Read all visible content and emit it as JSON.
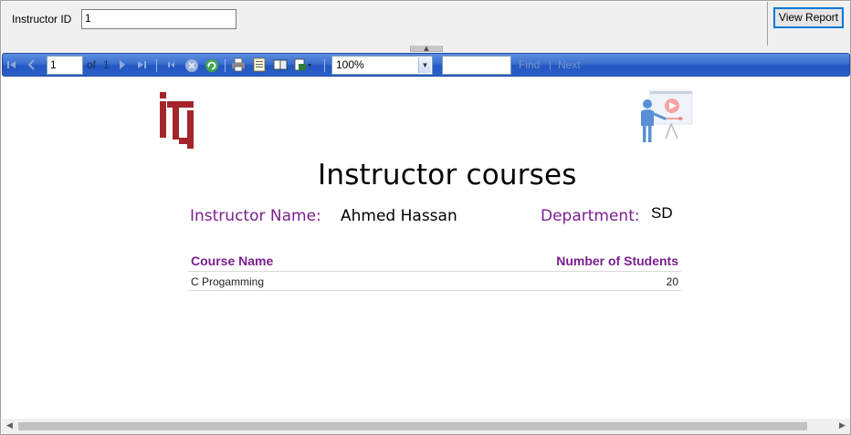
{
  "parameters": {
    "instructor_id_label": "Instructor ID",
    "instructor_id_value": "1",
    "view_report_label": "View Report"
  },
  "toolbar": {
    "page_value": "1",
    "of_label": "of",
    "total_pages": "1",
    "zoom_value": "100%",
    "find_value": "",
    "find_label": "Find",
    "separator": "|",
    "next_label": "Next",
    "icons": [
      "first-page-icon",
      "previous-page-icon",
      "next-page-icon",
      "last-page-icon",
      "back-icon",
      "stop-icon",
      "refresh-icon",
      "print-icon",
      "print-layout-icon",
      "page-setup-icon",
      "export-icon"
    ]
  },
  "report": {
    "title": "Instructor courses",
    "instructor_name_label": "Instructor Name:",
    "instructor_name_value": "Ahmed Hassan",
    "department_label": "Department:",
    "department_value": "SD",
    "table": {
      "headers": [
        "Course Name",
        "Number of Students"
      ],
      "rows": [
        [
          "C Progamming",
          "20"
        ]
      ]
    },
    "colors": {
      "label_purple": "#7a1f8f",
      "toolbar_blue": "#2a5fc9",
      "logo_red": "#a3252b"
    }
  }
}
